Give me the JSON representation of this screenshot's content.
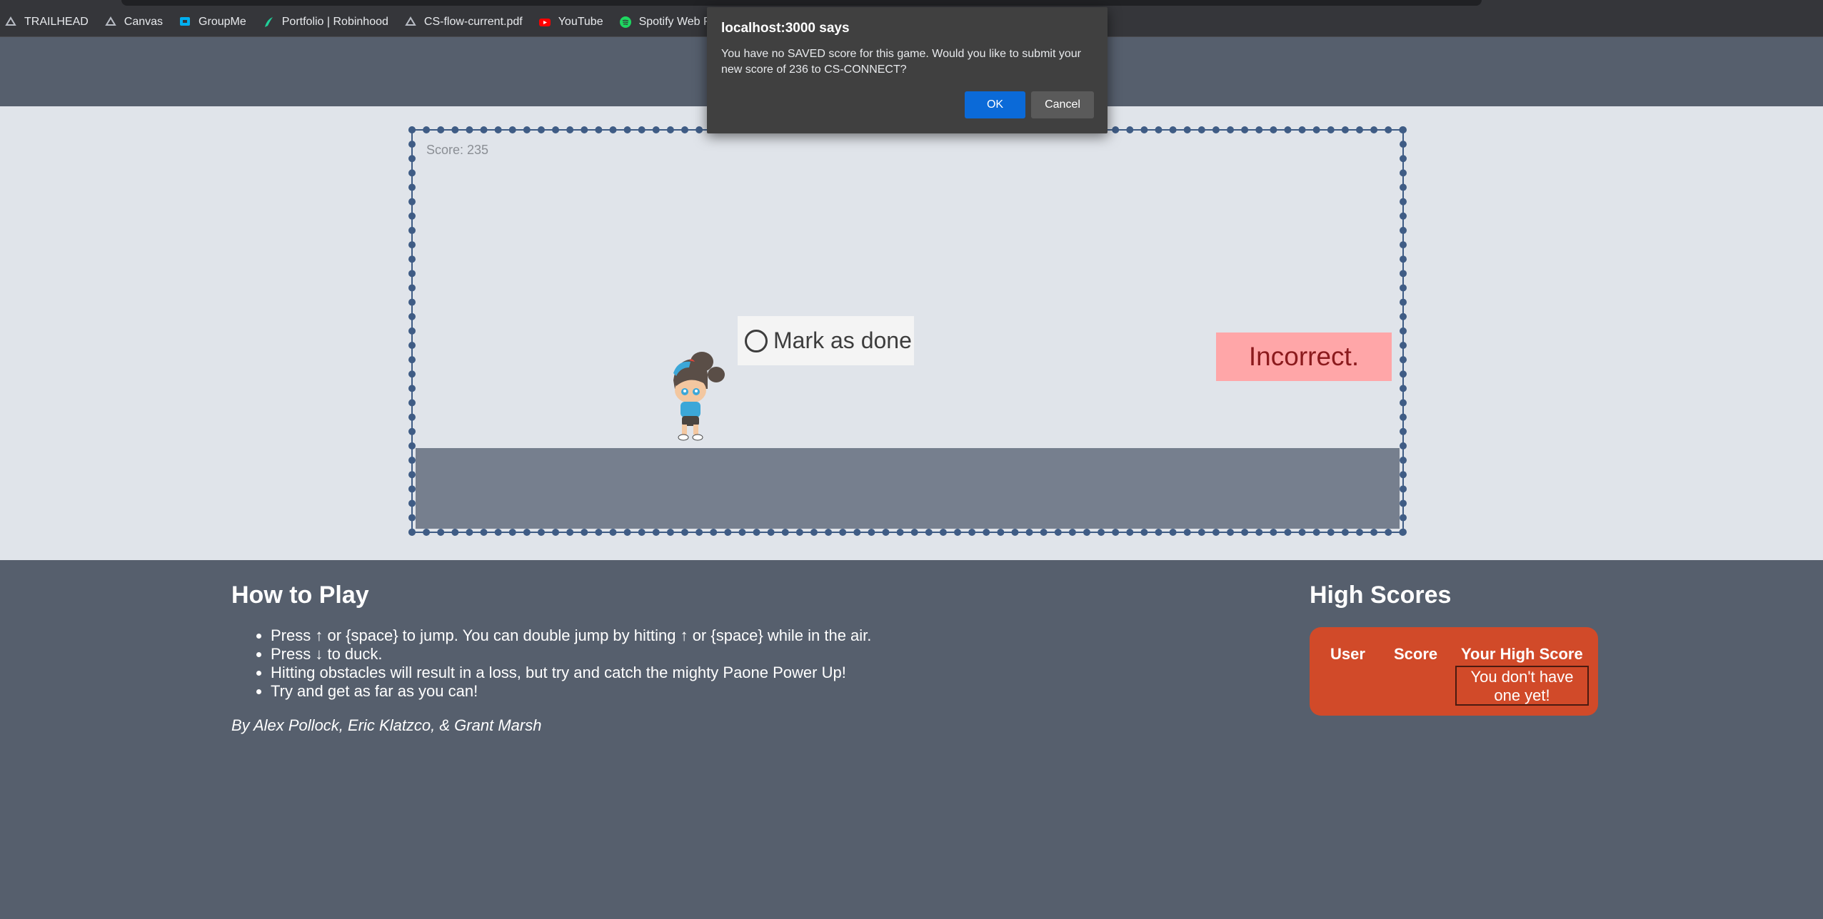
{
  "bookmarks": [
    {
      "label": "TRAILHEAD",
      "icon": "salesforce-cloud-icon"
    },
    {
      "label": "Canvas",
      "icon": "salesforce-cloud-icon"
    },
    {
      "label": "GroupMe",
      "icon": "groupme-icon"
    },
    {
      "label": "Portfolio | Robinhood",
      "icon": "robinhood-feather-icon"
    },
    {
      "label": "CS-flow-current.pdf",
      "icon": "salesforce-cloud-icon"
    },
    {
      "label": "YouTube",
      "icon": "youtube-icon"
    },
    {
      "label": "Spotify Web Player",
      "icon": "spotify-icon"
    }
  ],
  "game": {
    "score_label": "Score: 235",
    "mark_done": "Mark as done",
    "incorrect": "Incorrect."
  },
  "howto": {
    "title": "How to Play",
    "items": [
      "Press ↑ or {space} to jump. You can double jump by hitting ↑ or {space} while in the air.",
      "Press ↓ to duck.",
      "Hitting obstacles will result in a loss, but try and catch the mighty Paone Power Up!",
      "Try and get as far as you can!"
    ],
    "credits": "By Alex Pollock, Eric Klatzco, & Grant Marsh"
  },
  "high_scores": {
    "title": "High Scores",
    "col_user": "User",
    "col_score": "Score",
    "col_your": "Your High Score",
    "empty": "You don't have one yet!"
  },
  "dialog": {
    "title": "localhost:3000 says",
    "message": "You have no SAVED score for this game. Would you like to submit your new score of 236 to CS-CONNECT?",
    "ok": "OK",
    "cancel": "Cancel"
  },
  "colors": {
    "page_bg": "#565f6d",
    "game_bg": "#e0e4ea",
    "frame": "#3f5c85",
    "high_score_bg": "#d14a29",
    "ok_button": "#0b6ad8"
  }
}
